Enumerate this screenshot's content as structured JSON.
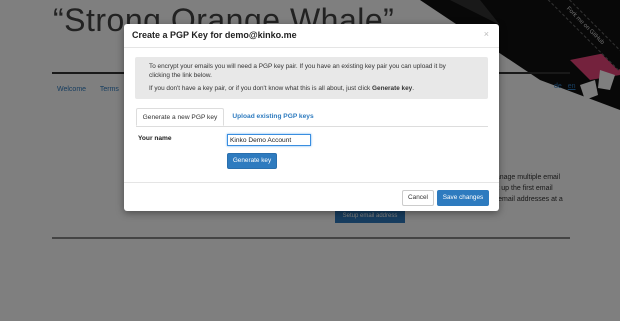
{
  "background": {
    "title": "“Strong Orange Whale”",
    "nav": [
      "Welcome",
      "Terms"
    ],
    "languages": [
      "de",
      "en"
    ],
    "right_text": [
      "manage multiple email",
      "set up the first email",
      "re email addresses at a"
    ],
    "setup_button": "Setup email address",
    "fork_ribbon": "Fork me on GitHub"
  },
  "modal": {
    "title": "Create a PGP Key for demo@kinko.me",
    "close": "×",
    "info": {
      "line1": "To encrypt your emails you will need a PGP key pair. If you have an existing key pair you can upload it by",
      "line2": "clicking the link below.",
      "line3_prefix": "If you don't have a key pair, or if you don't know what this is all about, just click ",
      "line3_bold": "Generate key",
      "line3_suffix": "."
    },
    "tabs": [
      "Generate a new PGP key",
      "Upload existing PGP keys"
    ],
    "name_label": "Your name",
    "name_value": "Kinko Demo Account",
    "generate_button": "Generate key",
    "cancel_button": "Cancel",
    "save_button": "Save changes"
  }
}
